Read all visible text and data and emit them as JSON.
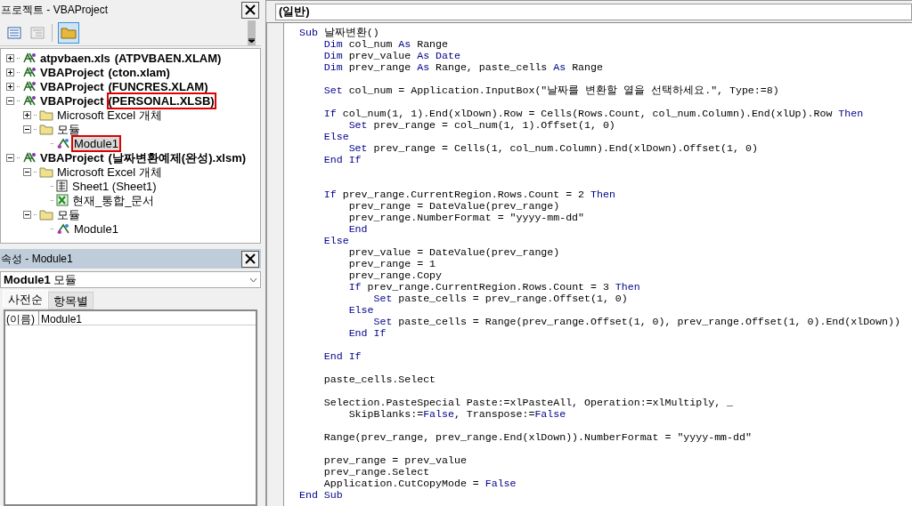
{
  "project_panel": {
    "title": "프로젝트 - VBAProject",
    "active": false,
    "tree": [
      {
        "label": "atpvbaen.xls",
        "file": "(ATPVBAEN.XLAM)",
        "kind": "project",
        "expanded": false,
        "selected": false,
        "highlighted": false
      },
      {
        "label": "VBAProject",
        "file": "(cton.xlam)",
        "kind": "project",
        "expanded": false,
        "selected": false,
        "highlighted": false
      },
      {
        "label": "VBAProject",
        "file": "(FUNCRES.XLAM)",
        "kind": "project",
        "expanded": false,
        "selected": false,
        "highlighted": false
      },
      {
        "label": "VBAProject",
        "file": "(PERSONAL.XLSB)",
        "kind": "project",
        "expanded": true,
        "selected": false,
        "highlighted": true,
        "children": [
          {
            "label": "Microsoft Excel 개체",
            "kind": "folder",
            "expanded": false,
            "selected": false,
            "highlighted": false
          },
          {
            "label": "모듈",
            "kind": "folder",
            "expanded": true,
            "selected": false,
            "highlighted": false,
            "children": [
              {
                "label": "Module1",
                "kind": "module",
                "selected": true,
                "highlighted": true
              }
            ]
          }
        ]
      },
      {
        "label": "VBAProject",
        "file": "(날짜변환예제(완성).xlsm)",
        "kind": "project",
        "expanded": true,
        "selected": false,
        "highlighted": false,
        "children": [
          {
            "label": "Microsoft Excel 개체",
            "kind": "folder",
            "expanded": true,
            "selected": false,
            "highlighted": false,
            "children": [
              {
                "label": "Sheet1 (Sheet1)",
                "kind": "sheet",
                "selected": false,
                "highlighted": false
              },
              {
                "label": "현재_통합_문서",
                "kind": "workbook",
                "selected": false,
                "highlighted": false
              }
            ]
          },
          {
            "label": "모듈",
            "kind": "folder",
            "expanded": true,
            "selected": false,
            "highlighted": false,
            "children": [
              {
                "label": "Module1",
                "kind": "module",
                "selected": false,
                "highlighted": false
              }
            ]
          }
        ]
      }
    ]
  },
  "properties_panel": {
    "title": "속성 - Module1",
    "active": true,
    "object_select": "**Module1** 모듈",
    "tabs": [
      {
        "label": "사전순",
        "selected": true
      },
      {
        "label": "항목별",
        "selected": false
      }
    ],
    "rows": [
      {
        "name": "(이름)",
        "value": "Module1"
      }
    ]
  },
  "editor": {
    "object_select": "(일반)",
    "lines": [
      {
        "kind": "code",
        "segments": [
          {
            "kind": "keyword",
            "text": "Sub"
          },
          {
            "kind": "plain",
            "text": " 날짜변환()"
          }
        ]
      },
      {
        "kind": "code",
        "segments": [
          {
            "kind": "keyword",
            "text": "    Dim"
          },
          {
            "kind": "plain",
            "text": " col_num "
          },
          {
            "kind": "keyword",
            "text": "As"
          },
          {
            "kind": "plain",
            "text": " Range"
          }
        ]
      },
      {
        "kind": "code",
        "segments": [
          {
            "kind": "keyword",
            "text": "    Dim"
          },
          {
            "kind": "plain",
            "text": " prev_value "
          },
          {
            "kind": "keyword",
            "text": "As Date"
          }
        ]
      },
      {
        "kind": "code",
        "segments": [
          {
            "kind": "keyword",
            "text": "    Dim"
          },
          {
            "kind": "plain",
            "text": " prev_range "
          },
          {
            "kind": "keyword",
            "text": "As"
          },
          {
            "kind": "plain",
            "text": " Range, paste_cells "
          },
          {
            "kind": "keyword",
            "text": "As"
          },
          {
            "kind": "plain",
            "text": " Range"
          }
        ]
      },
      {
        "kind": "blank"
      },
      {
        "kind": "code",
        "segments": [
          {
            "kind": "keyword",
            "text": "    Set"
          },
          {
            "kind": "plain",
            "text": " col_num = Application.InputBox(\"날짜를 변환할 열을 선택하세요.\", Type:=8)"
          }
        ]
      },
      {
        "kind": "blank"
      },
      {
        "kind": "code",
        "segments": [
          {
            "kind": "keyword",
            "text": "    If"
          },
          {
            "kind": "plain",
            "text": " col_num(1, 1).End(xlDown).Row = Cells(Rows.Count, col_num.Column).End(xlUp).Row "
          },
          {
            "kind": "keyword",
            "text": "Then"
          }
        ]
      },
      {
        "kind": "code",
        "segments": [
          {
            "kind": "keyword",
            "text": "        Set"
          },
          {
            "kind": "plain",
            "text": " prev_range = col_num(1, 1).Offset(1, 0)"
          }
        ]
      },
      {
        "kind": "code",
        "segments": [
          {
            "kind": "keyword",
            "text": "    Else"
          }
        ]
      },
      {
        "kind": "code",
        "segments": [
          {
            "kind": "keyword",
            "text": "        Set"
          },
          {
            "kind": "plain",
            "text": " prev_range = Cells(1, col_num.Column).End(xlDown).Offset(1, 0)"
          }
        ]
      },
      {
        "kind": "code",
        "segments": [
          {
            "kind": "keyword",
            "text": "    End If"
          }
        ]
      },
      {
        "kind": "blank"
      },
      {
        "kind": "blank"
      },
      {
        "kind": "code",
        "segments": [
          {
            "kind": "keyword",
            "text": "    If"
          },
          {
            "kind": "plain",
            "text": " prev_range.CurrentRegion.Rows.Count = 2 "
          },
          {
            "kind": "keyword",
            "text": "Then"
          }
        ]
      },
      {
        "kind": "code",
        "segments": [
          {
            "kind": "plain",
            "text": "        prev_range = DateValue(prev_range)"
          }
        ]
      },
      {
        "kind": "code",
        "segments": [
          {
            "kind": "plain",
            "text": "        prev_range.NumberFormat = \"yyyy-mm-dd\""
          }
        ]
      },
      {
        "kind": "code",
        "segments": [
          {
            "kind": "keyword",
            "text": "        End"
          }
        ]
      },
      {
        "kind": "code",
        "segments": [
          {
            "kind": "keyword",
            "text": "    Else"
          }
        ]
      },
      {
        "kind": "code",
        "segments": [
          {
            "kind": "plain",
            "text": "        prev_value = DateValue(prev_range)"
          }
        ]
      },
      {
        "kind": "code",
        "segments": [
          {
            "kind": "plain",
            "text": "        prev_range = 1"
          }
        ]
      },
      {
        "kind": "code",
        "segments": [
          {
            "kind": "plain",
            "text": "        prev_range.Copy"
          }
        ]
      },
      {
        "kind": "code",
        "segments": [
          {
            "kind": "keyword",
            "text": "        If"
          },
          {
            "kind": "plain",
            "text": " prev_range.CurrentRegion.Rows.Count = 3 "
          },
          {
            "kind": "keyword",
            "text": "Then"
          }
        ]
      },
      {
        "kind": "code",
        "segments": [
          {
            "kind": "keyword",
            "text": "            Set"
          },
          {
            "kind": "plain",
            "text": " paste_cells = prev_range.Offset(1, 0)"
          }
        ]
      },
      {
        "kind": "code",
        "segments": [
          {
            "kind": "keyword",
            "text": "        Else"
          }
        ]
      },
      {
        "kind": "code",
        "segments": [
          {
            "kind": "keyword",
            "text": "            Set"
          },
          {
            "kind": "plain",
            "text": " paste_cells = Range(prev_range.Offset(1, 0), prev_range.Offset(1, 0).End(xlDown))"
          }
        ]
      },
      {
        "kind": "code",
        "segments": [
          {
            "kind": "keyword",
            "text": "        End If"
          }
        ]
      },
      {
        "kind": "blank"
      },
      {
        "kind": "code",
        "segments": [
          {
            "kind": "keyword",
            "text": "    End If"
          }
        ]
      },
      {
        "kind": "blank"
      },
      {
        "kind": "code",
        "segments": [
          {
            "kind": "plain",
            "text": "    paste_cells.Select"
          }
        ]
      },
      {
        "kind": "blank"
      },
      {
        "kind": "code",
        "segments": [
          {
            "kind": "plain",
            "text": "    Selection.PasteSpecial Paste:=xlPasteAll, Operation:=xlMultiply, _"
          }
        ]
      },
      {
        "kind": "code",
        "segments": [
          {
            "kind": "plain",
            "text": "        SkipBlanks:="
          },
          {
            "kind": "keyword",
            "text": "False"
          },
          {
            "kind": "plain",
            "text": ", Transpose:="
          },
          {
            "kind": "keyword",
            "text": "False"
          }
        ]
      },
      {
        "kind": "blank"
      },
      {
        "kind": "code",
        "segments": [
          {
            "kind": "plain",
            "text": "    Range(prev_range, prev_range.End(xlDown)).NumberFormat = \"yyyy-mm-dd\""
          }
        ]
      },
      {
        "kind": "blank"
      },
      {
        "kind": "code",
        "segments": [
          {
            "kind": "plain",
            "text": "    prev_range = prev_value"
          }
        ]
      },
      {
        "kind": "code",
        "segments": [
          {
            "kind": "plain",
            "text": "    prev_range.Select"
          }
        ]
      },
      {
        "kind": "code",
        "segments": [
          {
            "kind": "plain",
            "text": "    Application.CutCopyMode = "
          },
          {
            "kind": "keyword",
            "text": "False"
          }
        ]
      },
      {
        "kind": "code",
        "segments": [
          {
            "kind": "keyword",
            "text": "End Sub"
          }
        ]
      }
    ]
  }
}
